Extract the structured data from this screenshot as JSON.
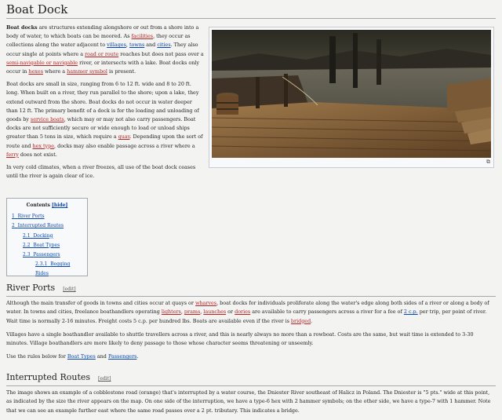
{
  "title": "Boat Dock",
  "lead": {
    "p1": {
      "b0": "Boat docks",
      "t1": " are structures extending alongshore or out from a shore into a body of water, to which boats can be moored. As ",
      "l1": "facilities",
      "t2": ", they occur as collections along the water adjacent to ",
      "l2": "villages",
      "t3": ", ",
      "l3": "towns",
      "t4": " and ",
      "l4": "cities",
      "t5": ". They also occur single at points where a ",
      "l5": "road or route",
      "t6": " reaches but does not pass over a ",
      "l6": "semi-navigable or navigable",
      "t7": " river, or intersects with a lake. Boat docks only occur in ",
      "l7": "hexes",
      "t8": " where a ",
      "l8": "hammer symbol",
      "t9": " is present."
    },
    "p2": {
      "t1": "Boat docks are small in size, ranging from 6 to 12 ft. wide and 8 to 20 ft. long. When built on a river, they run parallel to the shore; upon a lake, they extend outward from the shore. Boat docks do not occur in water deeper than 12 ft. The primary benefit of a dock is for the loading and unloading of goods by ",
      "l1": "service boats",
      "t2": ", which may or may not also carry passengers. Boat docks are not sufficiently secure or wide enough to load or unload ships greater than 5 tons in size, which require a ",
      "l2": "quay",
      "t3": ". Depending upon the sort of route and ",
      "l3": "hex type",
      "t4": ", docks may also enable passage across a river where a ",
      "l4": "ferry",
      "t5": " does not exist."
    },
    "p3": "In very cold climates, when a river freezes, all use of the boat dock ceases until the river is again clear of ice."
  },
  "image": {
    "magnify_icon": "magnify-icon"
  },
  "toc": {
    "title": "Contents",
    "hide": "[hide]",
    "items": [
      {
        "num": "1",
        "label": "River Ports"
      },
      {
        "num": "2",
        "label": "Interrupted Routes"
      },
      {
        "num": "2.1",
        "label": "Docking"
      },
      {
        "num": "2.2",
        "label": "Boat Types"
      },
      {
        "num": "2.3",
        "label": "Passengers"
      },
      {
        "num": "2.3.1",
        "label": "Begging Rides"
      }
    ]
  },
  "river_ports": {
    "heading": "River Ports",
    "edit": "[edit]",
    "p1": {
      "t1": "Although the main transfer of goods in towns and cities occur at quays or ",
      "l1": "wharves",
      "t2": ", boat docks for individuals proliferate along the water's edge along both sides of a river or along a body of water. In towns and cities, freelance boathandlers operating ",
      "l2": "lighters",
      "t3": ", ",
      "l3": "prams",
      "t4": ", ",
      "l4": "launches",
      "t5": " or ",
      "l5": "dories",
      "t6": " are available to carry passengers across a river for a fee of ",
      "l6": "2 c.p.",
      "t7": " per trip, per point of river. Wait time is normally 2-16 minutes. Freight costs 5 c.p. per hundred lbs. Boats are available even if the river is ",
      "l7": "bridged",
      "t8": "."
    },
    "p2": "Villages have a single boathandler available to shuttle travellers across a river, and this is nearly always no more than a rowboat. Costs are the same, but wait time is extended to 3-30 minutes. Village boathandlers are more likely to deny passage to those whose character seems threatening or unseemly.",
    "p3": {
      "t1": "Use the rules below for ",
      "l1": "Boat Types",
      "t2": " and ",
      "l2": "Passengers",
      "t3": "."
    }
  },
  "interrupted_routes": {
    "heading": "Interrupted Routes",
    "edit": "[edit]",
    "p1": "The image shows an example of a cobblestone road (orange) that's interrupted by a water course, the Dniester River southeast of Halicz in Poland. The Dniester is \"5 pts.\" wide at this point, as indicated by the size the river appears on the map. On one side of the interruption, we have a type-6 hex with 2 hammer symbols; on the other side, we have a type-7 with 1 hammer. Note that we can see an example further east where the same road passes over a 2 pt. tributary. This indicates a bridge."
  }
}
